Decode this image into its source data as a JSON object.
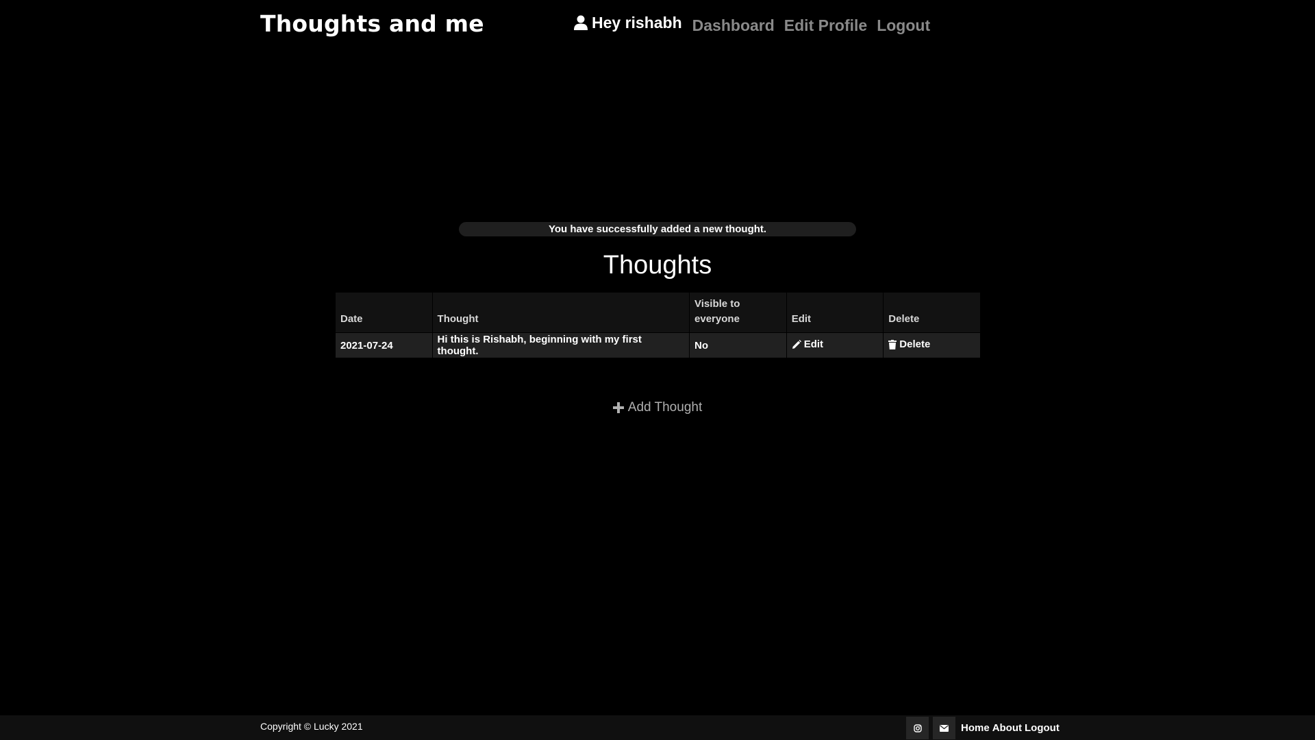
{
  "header": {
    "brand": "Thoughts and me",
    "greeting": "Hey rishabh",
    "nav": [
      {
        "label": "Dashboard"
      },
      {
        "label": "Edit Profile"
      },
      {
        "label": "Logout"
      }
    ]
  },
  "alert": {
    "message": "You have successfully added a new thought."
  },
  "main": {
    "title": "Thoughts",
    "table": {
      "headers": {
        "date": "Date",
        "thought": "Thought",
        "visible_line1": "Visible to",
        "visible_line2": "everyone",
        "edit": "Edit",
        "delete": "Delete"
      },
      "rows": [
        {
          "date": "2021-07-24",
          "thought": "Hi this is Rishabh, beginning with my first thought.",
          "visible": "No",
          "edit": "Edit",
          "delete": "Delete"
        }
      ]
    },
    "add_thought": "Add Thought"
  },
  "footer": {
    "copyright": "Copyright © Lucky 2021",
    "icons": [
      "instagram-icon",
      "envelope-icon"
    ],
    "links": [
      {
        "label": "Home"
      },
      {
        "label": "About"
      },
      {
        "label": "Logout"
      }
    ]
  },
  "colors": {
    "background": "#000000",
    "muted_link": "#8a8a8a",
    "table_header_bg": "#121212",
    "table_row_bg": "#212121",
    "alert_bg": "#1f1f1f",
    "footer_bg": "#101010"
  }
}
